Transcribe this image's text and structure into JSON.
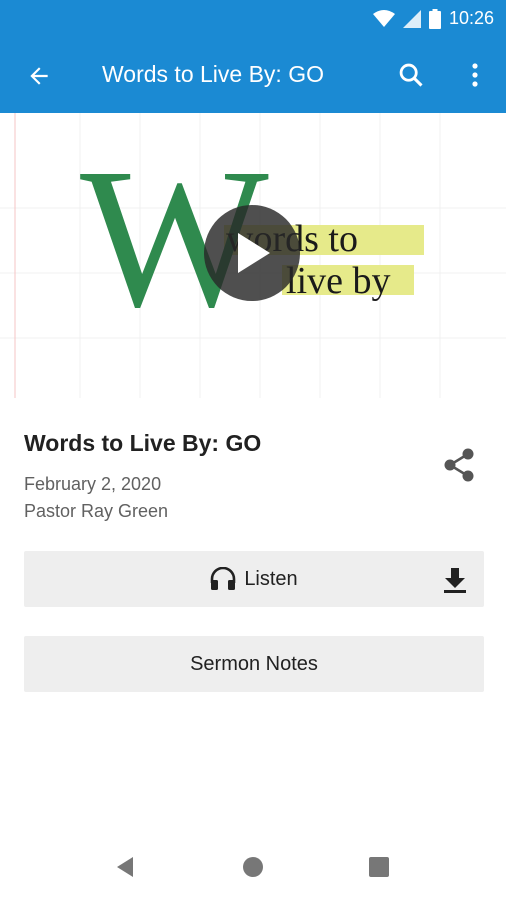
{
  "status_bar": {
    "time": "10:26",
    "color": "#1b8ad3"
  },
  "app_bar": {
    "title": "Words to Live By: GO",
    "icons": [
      "back-arrow-icon",
      "search-icon",
      "more-vertical-icon"
    ],
    "color": "#1b8ad3"
  },
  "hero": {
    "logo_letter": "W",
    "logo_line1": "words to",
    "logo_line2": "live by",
    "logo_colors": {
      "green": "#2f8a4e",
      "highlight": "#e6ea8a"
    }
  },
  "sermon": {
    "title": "Words to Live By: GO",
    "date": "February 2, 2020",
    "speaker": "Pastor Ray Green"
  },
  "actions": {
    "listen_label": "Listen",
    "notes_label": "Sermon Notes"
  }
}
